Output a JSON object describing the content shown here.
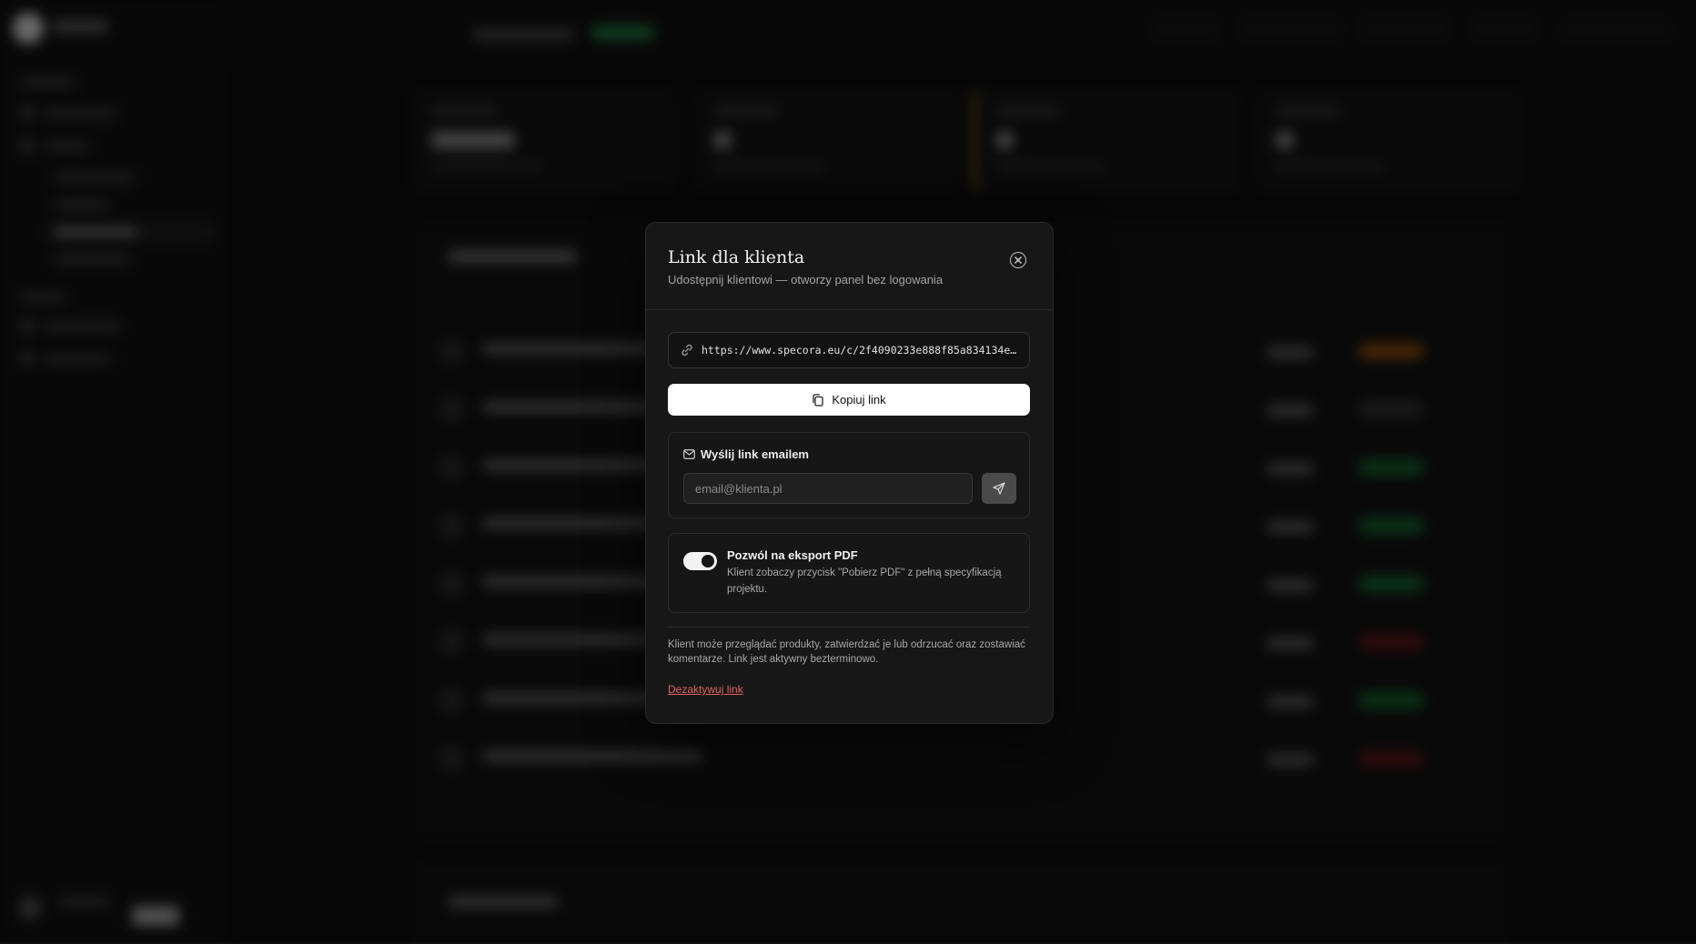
{
  "modal": {
    "title": "Link dla klienta",
    "subtitle": "Udostępnij klientowi — otworzy panel bez logowania",
    "url": "https://www.specora.eu/c/2f4090233e888f85a834134ead…",
    "copy_label": "Kopiuj link",
    "email_section": {
      "heading": "Wyślij link emailem",
      "placeholder": "email@klienta.pl",
      "value": ""
    },
    "pdf_export": {
      "enabled": true,
      "title": "Pozwól na eksport PDF",
      "description": "Klient zobaczy przycisk \"Pobierz PDF\" z pełną specyfikacją projektu."
    },
    "footnote": "Klient może przeglądać produkty, zatwierdzać je lub odrzucać oraz zostawiać komentarze. Link jest aktywny bezterminowo.",
    "deactivate_label": "Dezaktywuj link"
  },
  "icons": {
    "close": "close-icon",
    "url": "link-icon",
    "copy": "copy-icon",
    "email": "mail-icon",
    "send": "send-icon"
  },
  "colors": {
    "accent_button": "#ffffff",
    "danger_link": "#e0645c",
    "modal_bg": "#171717",
    "status_orange": "#b0620f",
    "status_green": "#1d8a45",
    "status_red": "#8a1f1f"
  }
}
